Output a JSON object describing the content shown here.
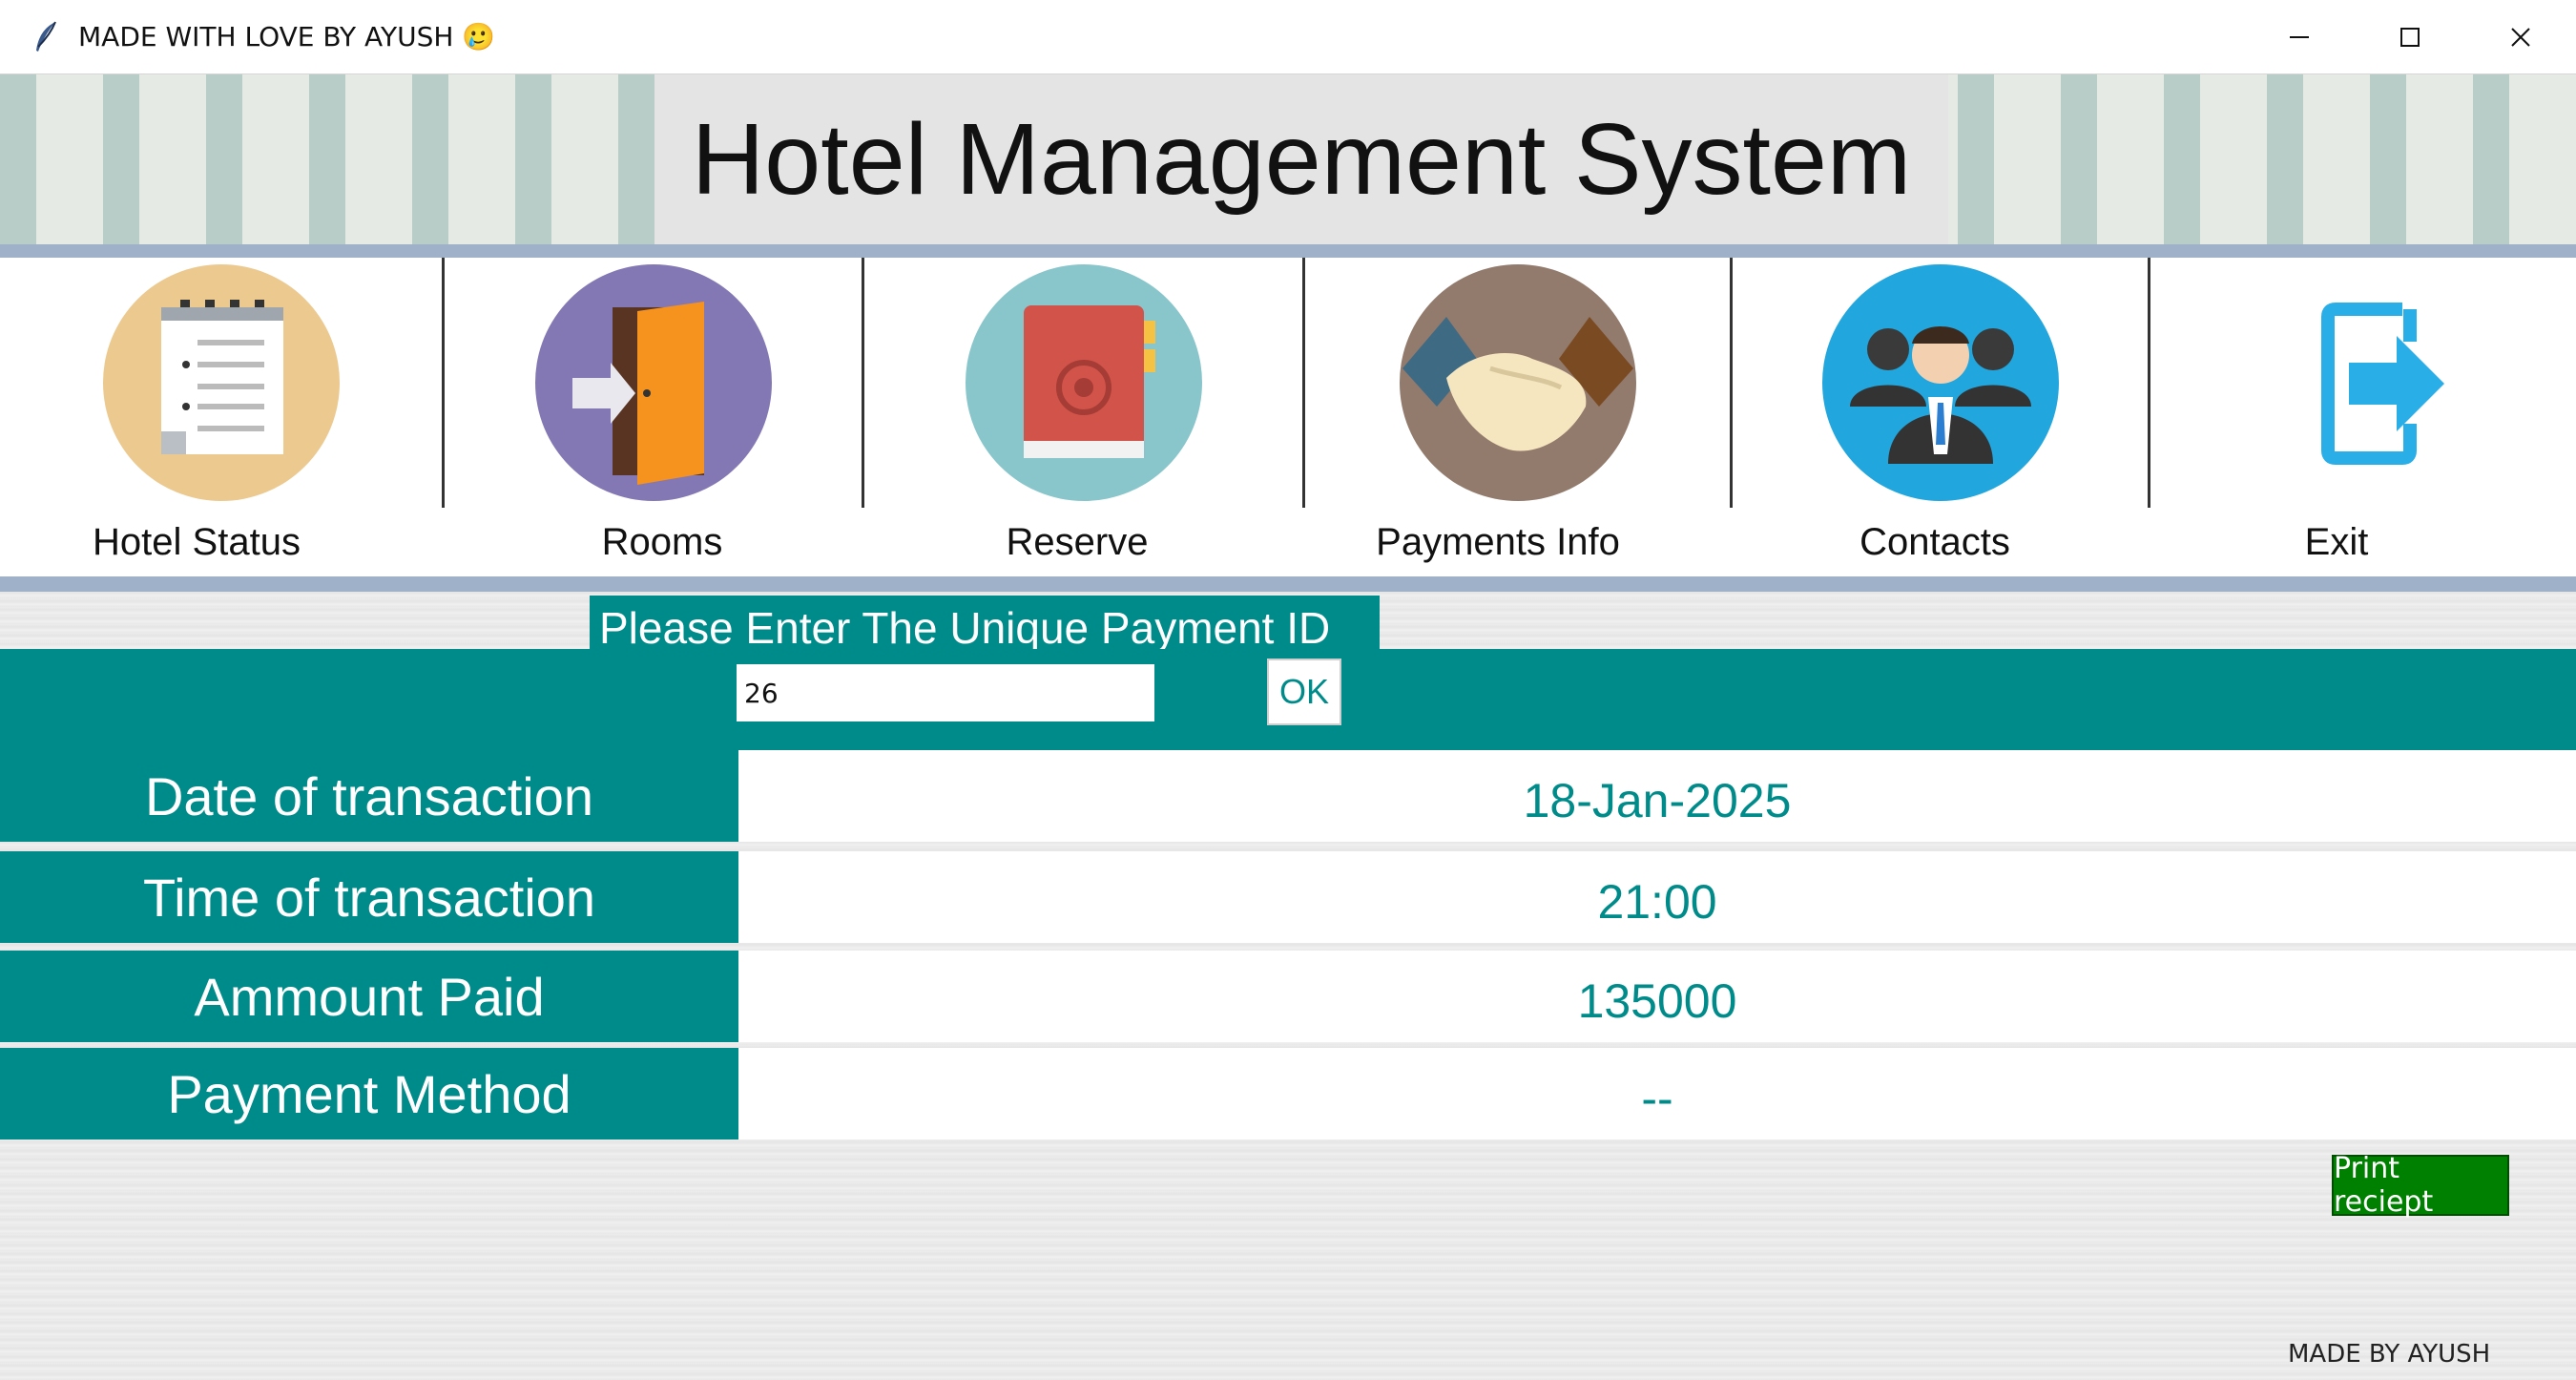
{
  "window": {
    "title": "MADE WITH LOVE BY AYUSH 🥲",
    "controls": [
      "minimize-icon",
      "maximize-icon",
      "close-icon"
    ]
  },
  "header": {
    "title": "Hotel Management System"
  },
  "nav": {
    "items": [
      {
        "label": "Hotel Status",
        "icon": "notepad-icon"
      },
      {
        "label": "Rooms",
        "icon": "door-icon"
      },
      {
        "label": "Reserve",
        "icon": "book-icon"
      },
      {
        "label": "Payments Info",
        "icon": "handshake-icon"
      },
      {
        "label": "Contacts",
        "icon": "people-icon"
      },
      {
        "label": "Exit",
        "icon": "exit-icon"
      }
    ]
  },
  "payment": {
    "prompt": "Please Enter The Unique Payment ID",
    "id_value": "26",
    "ok_label": "OK",
    "fields": [
      {
        "label": "Date of transaction",
        "value": "18-Jan-2025"
      },
      {
        "label": "Time of transaction",
        "value": "21:00"
      },
      {
        "label": "Ammount Paid",
        "value": "135000"
      },
      {
        "label": "Payment Method",
        "value": "--"
      }
    ],
    "print_label": "Print reciept"
  },
  "footer": {
    "credit": "MADE BY AYUSH"
  },
  "colors": {
    "teal": "#008b8b",
    "nav_bar": "#9fb1c8",
    "print_green": "#008000"
  }
}
